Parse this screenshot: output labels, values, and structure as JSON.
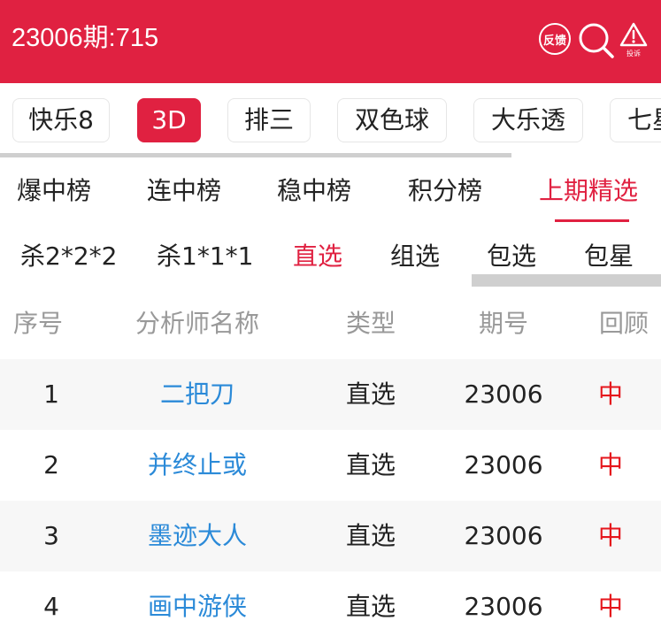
{
  "header": {
    "title": "23006期:715",
    "feedback_label": "反馈",
    "complain_label": "投诉"
  },
  "icons": {
    "search": "search-icon",
    "complain": "warning-icon"
  },
  "colors": {
    "brand_red": "#e02141",
    "link_blue": "#2b8ad8",
    "result_red": "#e5161c"
  },
  "lottery_tabs": [
    {
      "label": "快乐8"
    },
    {
      "label": "3D",
      "active": true
    },
    {
      "label": "排三"
    },
    {
      "label": "双色球"
    },
    {
      "label": "大乐透"
    },
    {
      "label": "七星彩"
    }
  ],
  "rank_tabs": [
    {
      "label": "爆中榜"
    },
    {
      "label": "连中榜"
    },
    {
      "label": "稳中榜"
    },
    {
      "label": "积分榜"
    },
    {
      "label": "上期精选",
      "active": true
    }
  ],
  "sub_tabs": [
    {
      "label": "杀2*2*2"
    },
    {
      "label": "杀1*1*1"
    },
    {
      "label": "直选",
      "active": true
    },
    {
      "label": "组选"
    },
    {
      "label": "包选"
    },
    {
      "label": "包星"
    }
  ],
  "table": {
    "headers": [
      "序号",
      "分析师名称",
      "类型",
      "期号",
      "回顾"
    ],
    "rows": [
      [
        "1",
        "二把刀",
        "直选",
        "23006",
        "中"
      ],
      [
        "2",
        "并终止或",
        "直选",
        "23006",
        "中"
      ],
      [
        "3",
        "墨迹大人",
        "直选",
        "23006",
        "中"
      ],
      [
        "4",
        "画中游侠",
        "直选",
        "23006",
        "中"
      ]
    ]
  }
}
